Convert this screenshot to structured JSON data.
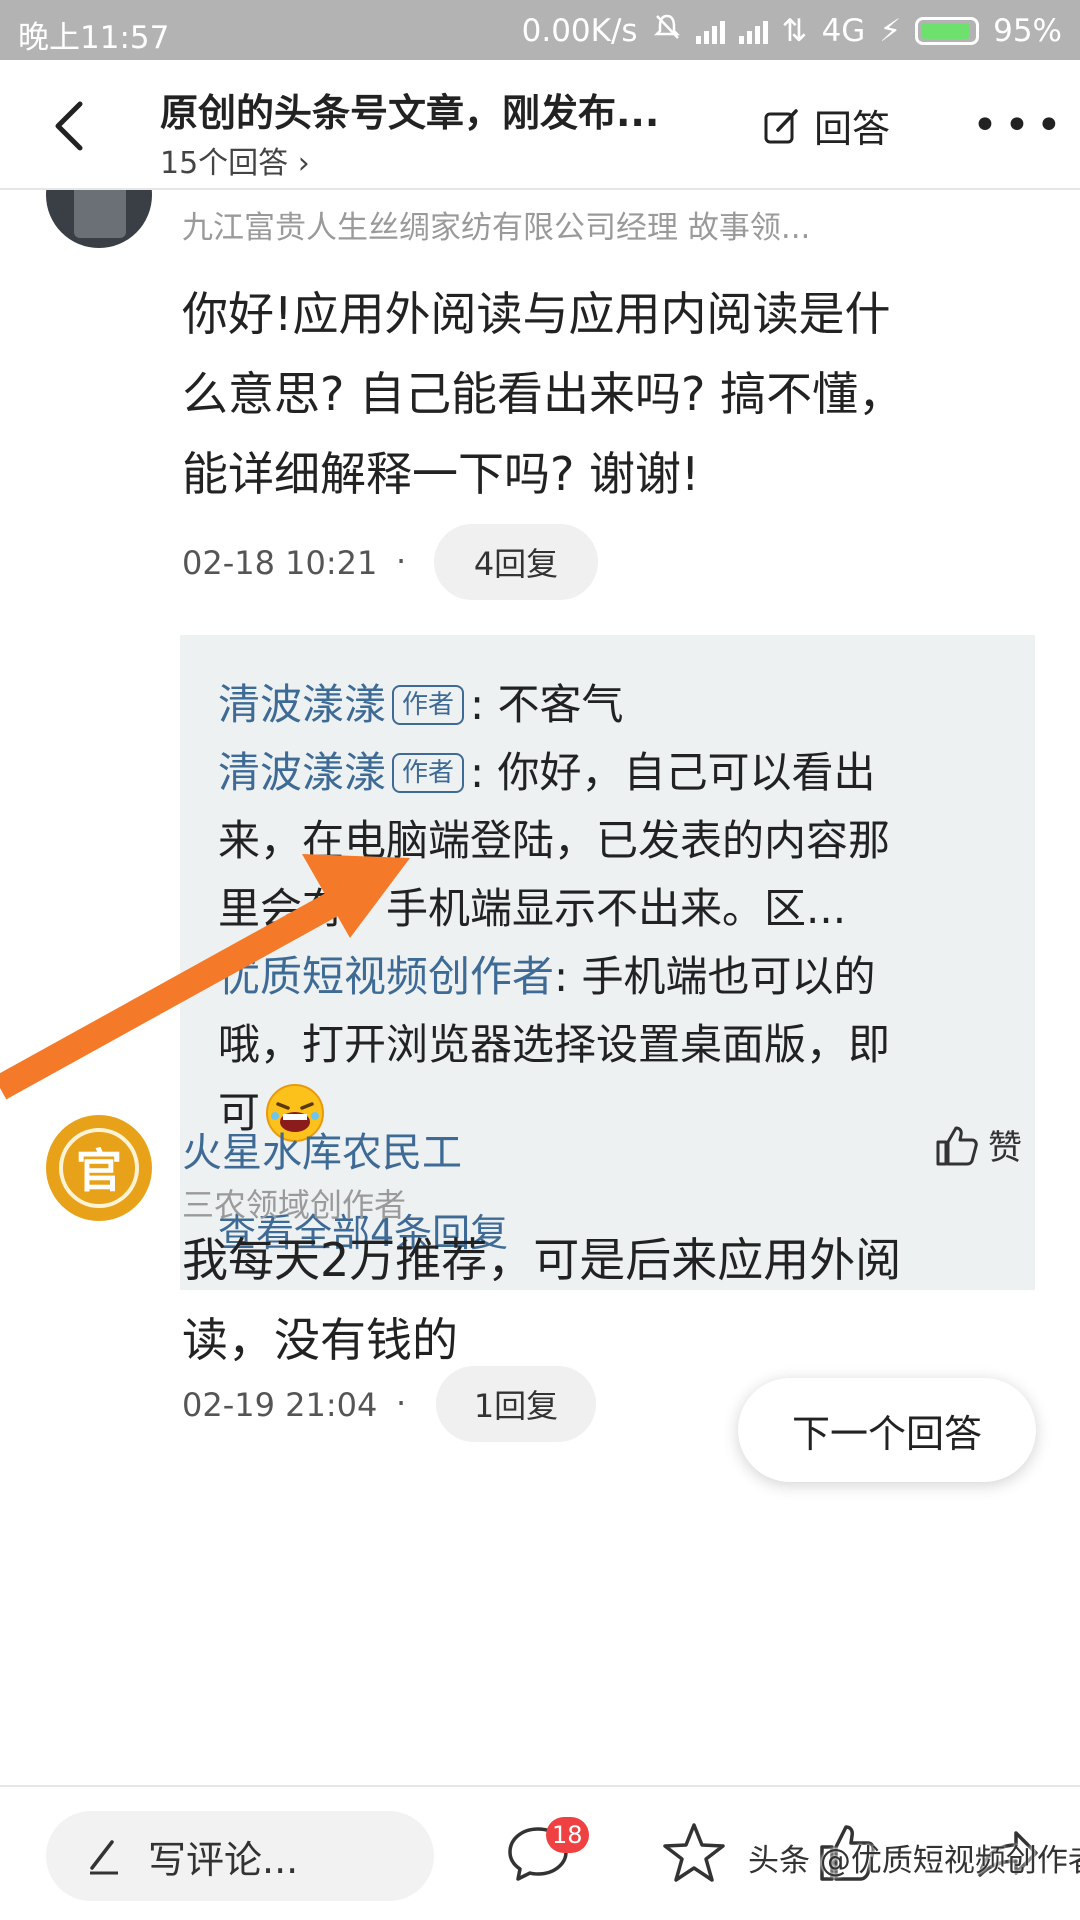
{
  "status_bar": {
    "time": "晚上11:57",
    "net_speed": "0.00K/s",
    "network": "4G",
    "battery": "95%",
    "battery_level": 0.95
  },
  "nav": {
    "title": "原创的头条号文章，刚发布...",
    "answer_count": "15个回答",
    "answer_button": "回答"
  },
  "post1": {
    "author_meta": "九江富贵人生丝绸家纺有限公司经理 故事领...",
    "lines": [
      "你好!应用外阅读与应用内阅读是什",
      "么意思? 自己能看出来吗? 搞不懂，",
      "能详细解释一下吗? 谢谢!"
    ],
    "time": "02-18 10:21",
    "reply_count": "4回复",
    "replies": {
      "r1_name": "清波漾漾",
      "r1_tag": "作者",
      "r1_text": ": 不客气",
      "r2_name": "清波漾漾",
      "r2_tag": "作者",
      "r2_line1": ": 你好，自己可以看出",
      "r2_line2": "来，在电脑端登陆，已发表的内容那",
      "r2_line3": "里会有。手机端显示不出来。区...",
      "r3_name": "优质短视频创作者",
      "r3_line1": ": 手机端也可以的",
      "r3_line2": "哦，打开浏览器选择设置桌面版，即",
      "r3_line3": "可",
      "view_all": "查看全部4条回复"
    }
  },
  "post2": {
    "avatar_text": "官",
    "author": "火星水库农民工",
    "author_meta": "三农领域创作者",
    "like_label": "赞",
    "lines": [
      "我每天2万推荐，可是后来应用外阅",
      "读，没有钱的"
    ],
    "time": "02-19 21:04",
    "reply_count": "1回复"
  },
  "next_answer": "下一个回答",
  "bottom_bar": {
    "write_placeholder": "写评论...",
    "comment_badge": "18",
    "watermark": "头条 @优质短视频创作者"
  },
  "colors": {
    "link_blue": "#3e6a96",
    "arrow_orange": "#f47a2a",
    "badge_red": "#f04142"
  }
}
